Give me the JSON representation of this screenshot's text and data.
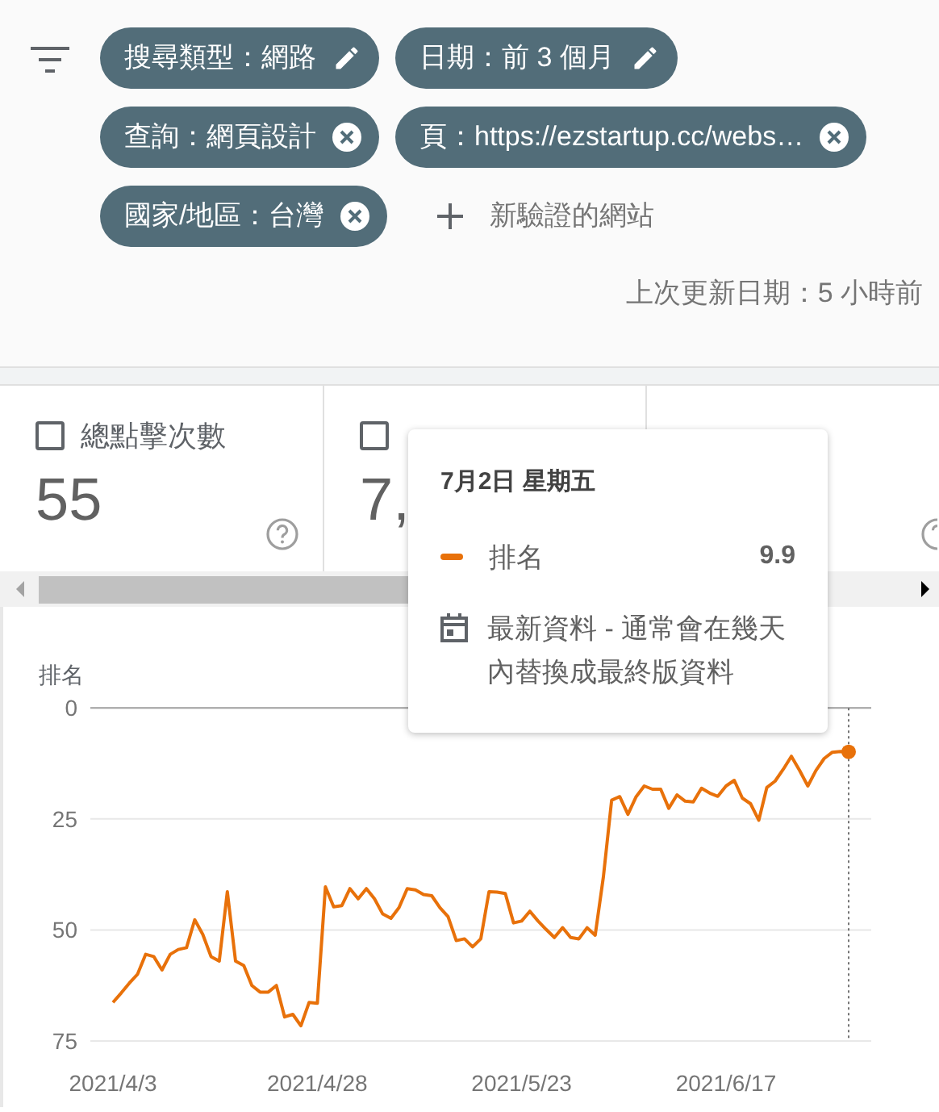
{
  "filters": [
    {
      "label": "搜尋類型：網路",
      "kind": "edit"
    },
    {
      "label": "日期：前 3 個月",
      "kind": "edit"
    },
    {
      "label": "查詢：網頁設計",
      "kind": "remove"
    },
    {
      "label": "頁：https://ezstartup.cc/webs…",
      "kind": "remove"
    },
    {
      "label": "國家/地區：台灣",
      "kind": "remove"
    }
  ],
  "add_filter": "新驗證的網站",
  "last_updated": "上次更新日期：5 小時前",
  "metrics": [
    {
      "label": "總點擊次數",
      "value": "55",
      "checked": false
    },
    {
      "value": "7,",
      "checked": false
    }
  ],
  "chart": {
    "chart_data": {
      "type": "line",
      "ylabel": "排名",
      "ylim": [
        75,
        0
      ],
      "yticks": [
        0,
        25,
        50,
        75
      ],
      "categories": [
        "2021/4/3",
        null,
        null,
        null,
        null,
        null,
        null,
        null,
        null,
        null,
        null,
        null,
        null,
        null,
        null,
        null,
        null,
        null,
        null,
        null,
        null,
        null,
        null,
        null,
        null,
        "2021/4/28",
        null,
        null,
        null,
        null,
        null,
        null,
        null,
        null,
        null,
        null,
        null,
        null,
        null,
        null,
        null,
        null,
        null,
        null,
        null,
        null,
        null,
        null,
        null,
        null,
        "2021/5/23",
        null,
        null,
        null,
        null,
        null,
        null,
        null,
        null,
        null,
        null,
        null,
        null,
        null,
        null,
        null,
        null,
        null,
        null,
        null,
        null,
        null,
        null,
        null,
        null,
        "2021/6/17",
        null,
        null,
        null,
        null,
        null,
        null,
        null,
        null,
        null,
        null,
        null,
        null,
        null,
        null,
        null
      ],
      "series": [
        {
          "name": "排名",
          "color": "#e8710a",
          "values": [
            66.3,
            64.2,
            62,
            60,
            55.5,
            56,
            59,
            55.5,
            54.4,
            54,
            47.7,
            51,
            56,
            57,
            41.4,
            57,
            58,
            62.5,
            64,
            64,
            62.5,
            69.6,
            69,
            71.6,
            66.3,
            66.5,
            40.3,
            44.8,
            44.5,
            40.7,
            43,
            40.7,
            43,
            46.4,
            47.4,
            45,
            40.7,
            41,
            42,
            42.3,
            45,
            47,
            52.4,
            52,
            53.8,
            52,
            41.4,
            41.5,
            41.8,
            48.4,
            48,
            45.8,
            48,
            49.9,
            51.7,
            49.5,
            51.7,
            52,
            49.5,
            51.2,
            38,
            20.8,
            20,
            24,
            20,
            17.6,
            18.3,
            18.3,
            22.6,
            19.6,
            21,
            21.2,
            18.1,
            19.2,
            19.9,
            17.6,
            16.3,
            20.3,
            21.6,
            25.3,
            17.9,
            16.5,
            13.8,
            10.9,
            14.1,
            17.6,
            14.1,
            11.4,
            10,
            9.8,
            9.9
          ]
        }
      ]
    }
  },
  "tooltip": {
    "date": "7月2日 星期五",
    "value": "9.9",
    "note": "最新資料 - 通常會在幾天內替換成最終版資料"
  }
}
